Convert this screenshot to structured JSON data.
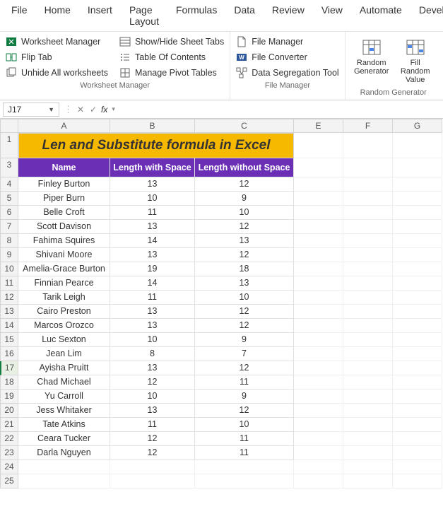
{
  "menu": [
    "File",
    "Home",
    "Insert",
    "Page Layout",
    "Formulas",
    "Data",
    "Review",
    "View",
    "Automate",
    "Develop"
  ],
  "ribbon": {
    "g1": {
      "c1": [
        "Worksheet Manager",
        "Flip Tab",
        "Unhide All worksheets"
      ],
      "c2": [
        "Show/Hide Sheet Tabs",
        "Table Of Contents",
        "Manage Pivot Tables"
      ],
      "label": "Worksheet Manager"
    },
    "g2": {
      "c1": [
        "File Manager",
        "File Converter",
        "Data Segregation Tool"
      ],
      "label": "File Manager"
    },
    "g3": {
      "b1": "Random Generator",
      "b2": "Fill Random Value",
      "label": "Random Generator"
    }
  },
  "namebox": "J17",
  "cols": [
    "A",
    "B",
    "C",
    "E",
    "F",
    "G"
  ],
  "title": "Len and Substitute formula in Excel",
  "headers": [
    "Name",
    "Length with Space",
    "Length without Space"
  ],
  "rows": [
    {
      "r": 4,
      "n": "Finley Burton",
      "a": "13",
      "b": "12"
    },
    {
      "r": 5,
      "n": "Piper Burn",
      "a": "10",
      "b": "9"
    },
    {
      "r": 6,
      "n": "Belle Croft",
      "a": "11",
      "b": "10"
    },
    {
      "r": 7,
      "n": "Scott Davison",
      "a": "13",
      "b": "12"
    },
    {
      "r": 8,
      "n": "Fahima Squires",
      "a": "14",
      "b": "13"
    },
    {
      "r": 9,
      "n": "Shivani Moore",
      "a": "13",
      "b": "12"
    },
    {
      "r": 10,
      "n": "Amelia-Grace Burton",
      "a": "19",
      "b": "18"
    },
    {
      "r": 11,
      "n": "Finnian Pearce",
      "a": "14",
      "b": "13"
    },
    {
      "r": 12,
      "n": "Tarik Leigh",
      "a": "11",
      "b": "10"
    },
    {
      "r": 13,
      "n": "Cairo Preston",
      "a": "13",
      "b": "12"
    },
    {
      "r": 14,
      "n": "Marcos Orozco",
      "a": "13",
      "b": "12"
    },
    {
      "r": 15,
      "n": "Luc Sexton",
      "a": "10",
      "b": "9"
    },
    {
      "r": 16,
      "n": "Jean Lim",
      "a": "8",
      "b": "7"
    },
    {
      "r": 17,
      "n": "Ayisha Pruitt",
      "a": "13",
      "b": "12"
    },
    {
      "r": 18,
      "n": "Chad Michael",
      "a": "12",
      "b": "11"
    },
    {
      "r": 19,
      "n": "Yu Carroll",
      "a": "10",
      "b": "9"
    },
    {
      "r": 20,
      "n": "Jess Whitaker",
      "a": "13",
      "b": "12"
    },
    {
      "r": 21,
      "n": "Tate Atkins",
      "a": "11",
      "b": "10"
    },
    {
      "r": 22,
      "n": "Ceara Tucker",
      "a": "12",
      "b": "11"
    },
    {
      "r": 23,
      "n": "Darla Nguyen",
      "a": "12",
      "b": "11"
    }
  ],
  "extra_rows": [
    24,
    25
  ],
  "selected_row": 17
}
